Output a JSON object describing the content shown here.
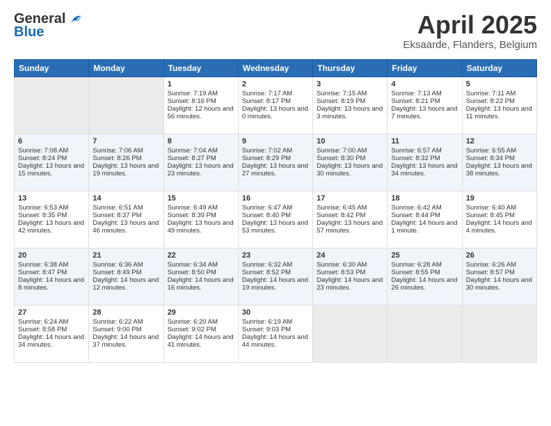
{
  "header": {
    "logo_general": "General",
    "logo_blue": "Blue",
    "title": "April 2025",
    "subtitle": "Eksaarde, Flanders, Belgium"
  },
  "days_header": [
    "Sunday",
    "Monday",
    "Tuesday",
    "Wednesday",
    "Thursday",
    "Friday",
    "Saturday"
  ],
  "weeks": [
    [
      {
        "num": "",
        "sunrise": "",
        "sunset": "",
        "daylight": "",
        "empty": true
      },
      {
        "num": "",
        "sunrise": "",
        "sunset": "",
        "daylight": "",
        "empty": true
      },
      {
        "num": "1",
        "sunrise": "Sunrise: 7:19 AM",
        "sunset": "Sunset: 8:16 PM",
        "daylight": "Daylight: 12 hours and 56 minutes."
      },
      {
        "num": "2",
        "sunrise": "Sunrise: 7:17 AM",
        "sunset": "Sunset: 8:17 PM",
        "daylight": "Daylight: 13 hours and 0 minutes."
      },
      {
        "num": "3",
        "sunrise": "Sunrise: 7:15 AM",
        "sunset": "Sunset: 8:19 PM",
        "daylight": "Daylight: 13 hours and 3 minutes."
      },
      {
        "num": "4",
        "sunrise": "Sunrise: 7:13 AM",
        "sunset": "Sunset: 8:21 PM",
        "daylight": "Daylight: 13 hours and 7 minutes."
      },
      {
        "num": "5",
        "sunrise": "Sunrise: 7:11 AM",
        "sunset": "Sunset: 8:22 PM",
        "daylight": "Daylight: 13 hours and 11 minutes."
      }
    ],
    [
      {
        "num": "6",
        "sunrise": "Sunrise: 7:08 AM",
        "sunset": "Sunset: 8:24 PM",
        "daylight": "Daylight: 13 hours and 15 minutes."
      },
      {
        "num": "7",
        "sunrise": "Sunrise: 7:06 AM",
        "sunset": "Sunset: 8:26 PM",
        "daylight": "Daylight: 13 hours and 19 minutes."
      },
      {
        "num": "8",
        "sunrise": "Sunrise: 7:04 AM",
        "sunset": "Sunset: 8:27 PM",
        "daylight": "Daylight: 13 hours and 23 minutes."
      },
      {
        "num": "9",
        "sunrise": "Sunrise: 7:02 AM",
        "sunset": "Sunset: 8:29 PM",
        "daylight": "Daylight: 13 hours and 27 minutes."
      },
      {
        "num": "10",
        "sunrise": "Sunrise: 7:00 AM",
        "sunset": "Sunset: 8:30 PM",
        "daylight": "Daylight: 13 hours and 30 minutes."
      },
      {
        "num": "11",
        "sunrise": "Sunrise: 6:57 AM",
        "sunset": "Sunset: 8:32 PM",
        "daylight": "Daylight: 13 hours and 34 minutes."
      },
      {
        "num": "12",
        "sunrise": "Sunrise: 6:55 AM",
        "sunset": "Sunset: 8:34 PM",
        "daylight": "Daylight: 13 hours and 38 minutes."
      }
    ],
    [
      {
        "num": "13",
        "sunrise": "Sunrise: 6:53 AM",
        "sunset": "Sunset: 8:35 PM",
        "daylight": "Daylight: 13 hours and 42 minutes."
      },
      {
        "num": "14",
        "sunrise": "Sunrise: 6:51 AM",
        "sunset": "Sunset: 8:37 PM",
        "daylight": "Daylight: 13 hours and 46 minutes."
      },
      {
        "num": "15",
        "sunrise": "Sunrise: 6:49 AM",
        "sunset": "Sunset: 8:39 PM",
        "daylight": "Daylight: 13 hours and 49 minutes."
      },
      {
        "num": "16",
        "sunrise": "Sunrise: 6:47 AM",
        "sunset": "Sunset: 8:40 PM",
        "daylight": "Daylight: 13 hours and 53 minutes."
      },
      {
        "num": "17",
        "sunrise": "Sunrise: 6:45 AM",
        "sunset": "Sunset: 8:42 PM",
        "daylight": "Daylight: 13 hours and 57 minutes."
      },
      {
        "num": "18",
        "sunrise": "Sunrise: 6:42 AM",
        "sunset": "Sunset: 8:44 PM",
        "daylight": "Daylight: 14 hours and 1 minute."
      },
      {
        "num": "19",
        "sunrise": "Sunrise: 6:40 AM",
        "sunset": "Sunset: 8:45 PM",
        "daylight": "Daylight: 14 hours and 4 minutes."
      }
    ],
    [
      {
        "num": "20",
        "sunrise": "Sunrise: 6:38 AM",
        "sunset": "Sunset: 8:47 PM",
        "daylight": "Daylight: 14 hours and 8 minutes."
      },
      {
        "num": "21",
        "sunrise": "Sunrise: 6:36 AM",
        "sunset": "Sunset: 8:49 PM",
        "daylight": "Daylight: 14 hours and 12 minutes."
      },
      {
        "num": "22",
        "sunrise": "Sunrise: 6:34 AM",
        "sunset": "Sunset: 8:50 PM",
        "daylight": "Daylight: 14 hours and 16 minutes."
      },
      {
        "num": "23",
        "sunrise": "Sunrise: 6:32 AM",
        "sunset": "Sunset: 8:52 PM",
        "daylight": "Daylight: 14 hours and 19 minutes."
      },
      {
        "num": "24",
        "sunrise": "Sunrise: 6:30 AM",
        "sunset": "Sunset: 8:53 PM",
        "daylight": "Daylight: 14 hours and 23 minutes."
      },
      {
        "num": "25",
        "sunrise": "Sunrise: 6:28 AM",
        "sunset": "Sunset: 8:55 PM",
        "daylight": "Daylight: 14 hours and 26 minutes."
      },
      {
        "num": "26",
        "sunrise": "Sunrise: 6:26 AM",
        "sunset": "Sunset: 8:57 PM",
        "daylight": "Daylight: 14 hours and 30 minutes."
      }
    ],
    [
      {
        "num": "27",
        "sunrise": "Sunrise: 6:24 AM",
        "sunset": "Sunset: 8:58 PM",
        "daylight": "Daylight: 14 hours and 34 minutes."
      },
      {
        "num": "28",
        "sunrise": "Sunrise: 6:22 AM",
        "sunset": "Sunset: 9:00 PM",
        "daylight": "Daylight: 14 hours and 37 minutes."
      },
      {
        "num": "29",
        "sunrise": "Sunrise: 6:20 AM",
        "sunset": "Sunset: 9:02 PM",
        "daylight": "Daylight: 14 hours and 41 minutes."
      },
      {
        "num": "30",
        "sunrise": "Sunrise: 6:19 AM",
        "sunset": "Sunset: 9:03 PM",
        "daylight": "Daylight: 14 hours and 44 minutes."
      },
      {
        "num": "",
        "sunrise": "",
        "sunset": "",
        "daylight": "",
        "empty": true
      },
      {
        "num": "",
        "sunrise": "",
        "sunset": "",
        "daylight": "",
        "empty": true
      },
      {
        "num": "",
        "sunrise": "",
        "sunset": "",
        "daylight": "",
        "empty": true
      }
    ]
  ]
}
